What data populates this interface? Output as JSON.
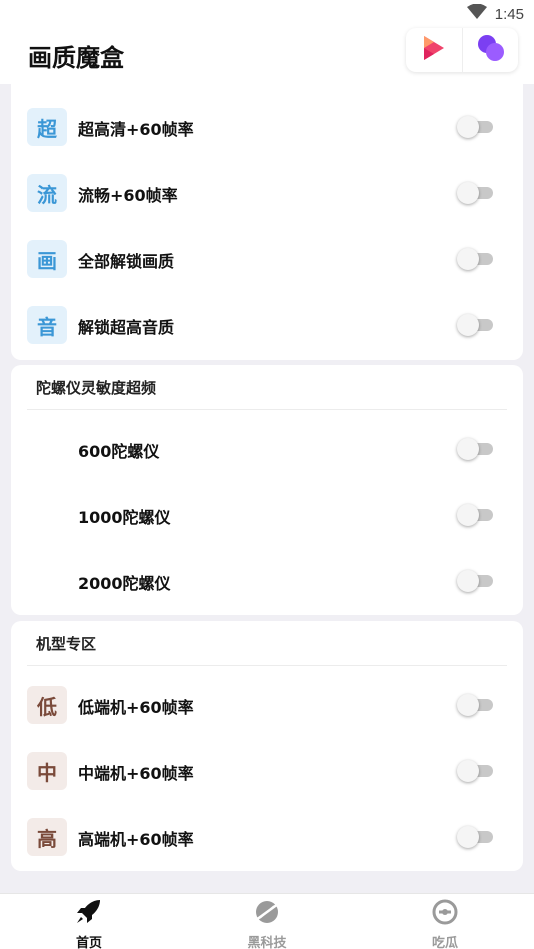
{
  "status_bar": {
    "time": "1:45",
    "wifi_icon": "wifi-icon"
  },
  "app_bar": {
    "title": "画质魔盒",
    "actions": [
      {
        "icon": "video-play-app-icon",
        "color": "#f0436b"
      },
      {
        "icon": "purple-bubbles-app-icon",
        "color": "#7b3ff2"
      }
    ]
  },
  "sections": [
    {
      "header": "",
      "items": [
        {
          "badge": "超",
          "label": "超高清+60帧率",
          "enabled": false
        },
        {
          "badge": "流",
          "label": "流畅+60帧率",
          "enabled": false
        },
        {
          "badge": "画",
          "label": "全部解锁画质",
          "enabled": false
        },
        {
          "badge": "音",
          "label": "解锁超高音质",
          "enabled": false
        }
      ]
    },
    {
      "header": "陀螺仪灵敏度超频",
      "items": [
        {
          "label": "600陀螺仪",
          "enabled": false
        },
        {
          "label": "1000陀螺仪",
          "enabled": false
        },
        {
          "label": "2000陀螺仪",
          "enabled": false
        }
      ]
    },
    {
      "header": "机型专区",
      "items": [
        {
          "badge": "低",
          "label": "低端机+60帧率",
          "enabled": false
        },
        {
          "badge": "中",
          "label": "中端机+60帧率",
          "enabled": false
        },
        {
          "badge": "高",
          "label": "高端机+60帧率",
          "enabled": false
        }
      ]
    }
  ],
  "bottom_nav": [
    {
      "label": "首页",
      "icon": "rocket-icon",
      "active": true
    },
    {
      "label": "黑科技",
      "icon": "planet-icon",
      "active": false
    },
    {
      "label": "吃瓜",
      "icon": "melon-icon",
      "active": false
    }
  ],
  "colors": {
    "badge_blue": "#3b97d6",
    "badge_brown": "#7a4a3a",
    "toggle_off": "#c8c8c8"
  }
}
